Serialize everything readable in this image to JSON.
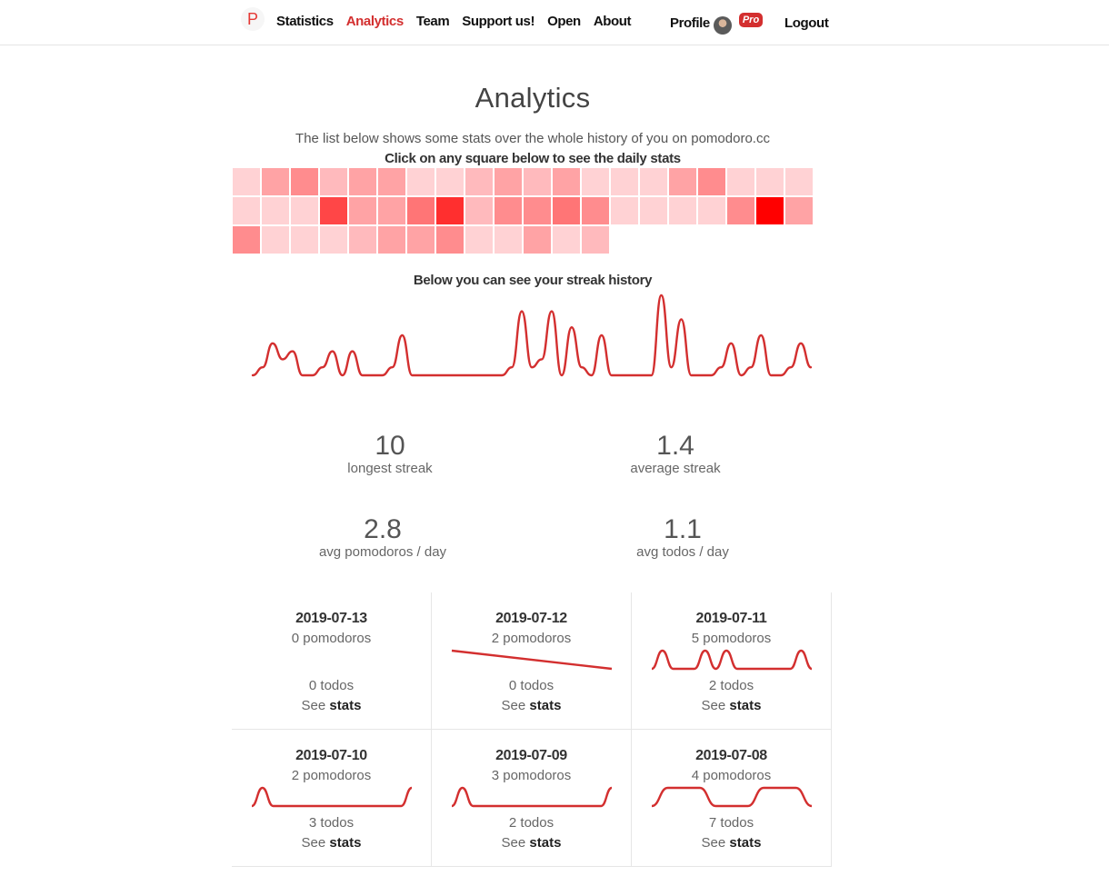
{
  "nav": {
    "logo": "P",
    "links": [
      "Statistics",
      "Analytics",
      "Team",
      "Support us!",
      "Open",
      "About"
    ],
    "active": "Analytics",
    "profile": "Profile",
    "pro": "Pro",
    "logout": "Logout"
  },
  "title": "Analytics",
  "subtitle": "The list below shows some stats over the whole history of you on pomodoro.cc",
  "instruction": "Click on any square below to see the daily stats",
  "heatmap": {
    "columns": 20,
    "levels": [
      1,
      3,
      4,
      2,
      3,
      3,
      1,
      1,
      2,
      3,
      2,
      3,
      1,
      1,
      1,
      3,
      4,
      1,
      1,
      1,
      1,
      1,
      1,
      7,
      3,
      3,
      5,
      8,
      2,
      4,
      4,
      5,
      4,
      1,
      1,
      1,
      1,
      4,
      10,
      3,
      4,
      1,
      1,
      1,
      2,
      3,
      3,
      4,
      1,
      1,
      3,
      1,
      2
    ],
    "colors": {
      "low": "#ffe9ec",
      "high": "#ff0000"
    }
  },
  "streak": {
    "title": "Below you can see your streak history",
    "values": [
      0,
      1,
      4,
      2,
      3,
      0,
      0,
      1,
      3,
      0,
      3,
      0,
      0,
      0,
      1,
      5,
      0,
      0,
      0,
      0,
      0,
      0,
      0,
      0,
      0,
      0,
      1,
      8,
      1,
      2,
      8,
      0,
      6,
      1,
      0,
      5,
      0,
      0,
      0,
      0,
      0,
      10,
      1,
      7,
      0,
      0,
      0,
      1,
      4,
      0,
      1,
      5,
      0,
      0,
      1,
      4,
      1
    ],
    "color": "#d32f2f"
  },
  "stats": {
    "longest_streak": {
      "value": "10",
      "label": "longest streak"
    },
    "average_streak": {
      "value": "1.4",
      "label": "average streak"
    },
    "avg_pomodoros": {
      "value": "2.8",
      "label": "avg pomodoros / day"
    },
    "avg_todos": {
      "value": "1.1",
      "label": "avg todos / day"
    }
  },
  "days": [
    {
      "date": "2019-07-13",
      "pomodoros": "0 pomodoros",
      "todos": "0 todos",
      "see": "See",
      "link": "stats",
      "spark": []
    },
    {
      "date": "2019-07-12",
      "pomodoros": "2 pomodoros",
      "todos": "0 todos",
      "see": "See",
      "link": "stats",
      "spark": [
        1,
        0
      ]
    },
    {
      "date": "2019-07-11",
      "pomodoros": "5 pomodoros",
      "todos": "2 todos",
      "see": "See",
      "link": "stats",
      "spark": [
        0,
        1,
        0,
        0,
        0,
        1,
        0,
        1,
        0,
        0,
        0,
        0,
        0,
        0,
        1,
        0
      ]
    },
    {
      "date": "2019-07-10",
      "pomodoros": "2 pomodoros",
      "todos": "3 todos",
      "see": "See",
      "link": "stats",
      "spark": [
        0,
        1,
        0,
        0,
        0,
        0,
        0,
        0,
        0,
        0,
        0,
        0,
        0,
        0,
        0,
        1
      ]
    },
    {
      "date": "2019-07-09",
      "pomodoros": "3 pomodoros",
      "todos": "2 todos",
      "see": "See",
      "link": "stats",
      "spark": [
        0,
        1,
        0,
        0,
        0,
        0,
        0,
        0,
        0,
        0,
        0,
        0,
        0,
        0,
        0,
        1
      ]
    },
    {
      "date": "2019-07-08",
      "pomodoros": "4 pomodoros",
      "todos": "7 todos",
      "see": "See",
      "link": "stats",
      "spark": [
        0,
        1,
        1,
        1,
        0,
        0,
        0,
        1,
        1,
        1,
        0
      ]
    }
  ]
}
